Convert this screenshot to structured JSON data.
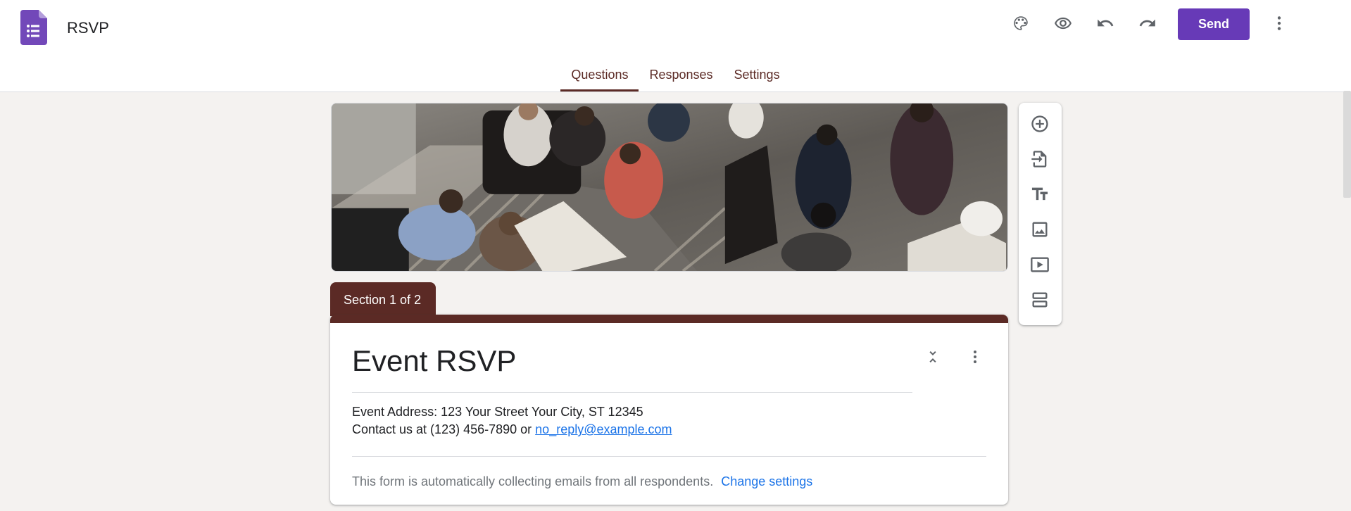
{
  "header": {
    "doc_title": "RSVP",
    "send_label": "Send",
    "icons": [
      "palette-icon",
      "eye-icon",
      "undo-icon",
      "redo-icon",
      "more-vert-icon"
    ],
    "accent_color": "#673ab7"
  },
  "tabs": [
    {
      "label": "Questions",
      "active": true
    },
    {
      "label": "Responses",
      "active": false
    },
    {
      "label": "Settings",
      "active": false
    }
  ],
  "theme": {
    "section_color": "#5b2a25",
    "background": "#f4f2f0",
    "link_color": "#1a73e8"
  },
  "section": {
    "tab_label": "Section 1 of 2"
  },
  "form": {
    "title": "Event RSVP",
    "address_line": "Event Address: 123 Your Street Your City, ST 12345",
    "contact_prefix": "Contact us at (123) 456-7890 or",
    "contact_email": "no_reply@example.com",
    "email_note": "This form is automatically collecting emails from all respondents.",
    "change_settings_label": "Change settings"
  },
  "toolbar": {
    "items": [
      "add-question-icon",
      "import-questions-icon",
      "add-title-icon",
      "add-image-icon",
      "add-video-icon",
      "add-section-icon"
    ]
  }
}
